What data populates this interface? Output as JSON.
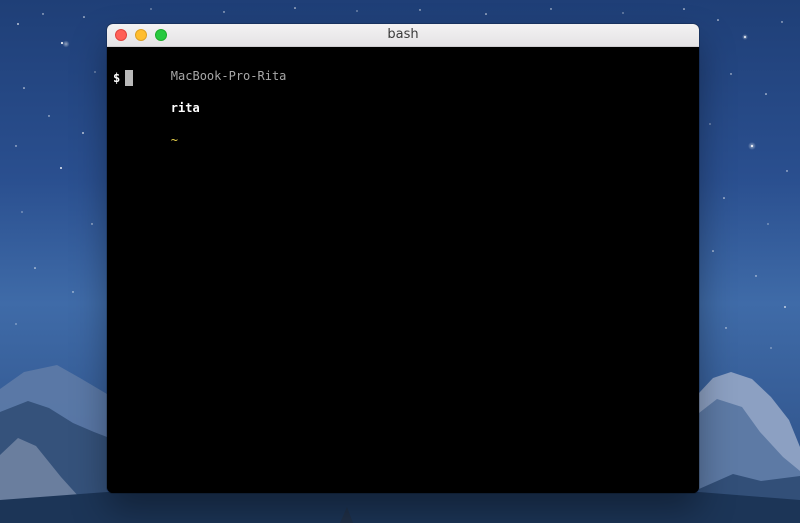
{
  "desktop": {
    "scene": "mountain night wallpaper"
  },
  "window": {
    "title": "bash",
    "controls": {
      "close_icon": "close-icon",
      "minimize_icon": "minimize-icon",
      "zoom_icon": "zoom-icon"
    }
  },
  "terminal": {
    "hostname": "MacBook-Pro-Rita",
    "username": "rita",
    "path": "~",
    "prompt_symbol": "$",
    "cursor_symbol": "block-cursor"
  },
  "colors": {
    "close_button": "#ff5f57",
    "minimize_button": "#ffbd2e",
    "zoom_button": "#28c940",
    "terminal_background": "#000000",
    "hostname_text": "#a7a7a7",
    "username_text": "#ffffff",
    "path_text": "#e7d14b"
  }
}
